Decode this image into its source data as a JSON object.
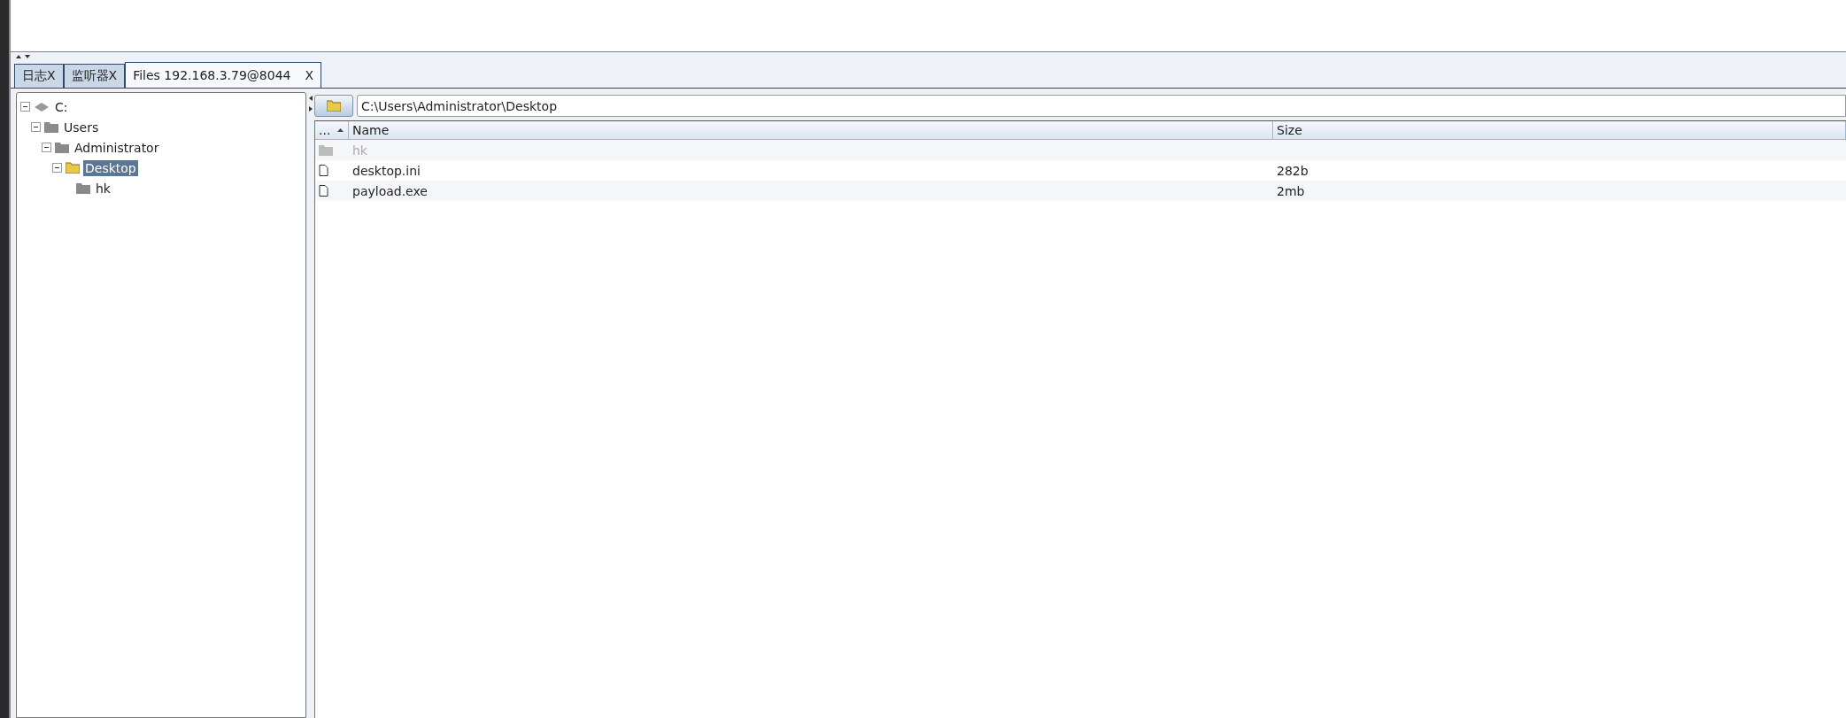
{
  "tabs": [
    {
      "label": "日志X",
      "selected": false
    },
    {
      "label": "监听器X",
      "selected": false
    },
    {
      "label": "Files 192.168.3.79@8044",
      "close": "X",
      "selected": true
    }
  ],
  "tree": [
    {
      "label": "C:",
      "kind": "drive",
      "expanded": true,
      "selected": false,
      "children": [
        {
          "label": "Users",
          "kind": "folder",
          "expanded": true,
          "selected": false,
          "children": [
            {
              "label": "Administrator",
              "kind": "folder",
              "expanded": true,
              "selected": false,
              "children": [
                {
                  "label": "Desktop",
                  "kind": "folder",
                  "expanded": true,
                  "selected": true,
                  "children": [
                    {
                      "label": "hk",
                      "kind": "folder",
                      "expanded": false,
                      "selected": false
                    }
                  ]
                }
              ]
            }
          ]
        }
      ]
    }
  ],
  "path": {
    "value": "C:\\Users\\Administrator\\Desktop"
  },
  "table": {
    "columns": [
      "...",
      "Name",
      "Size"
    ],
    "rows": [
      {
        "kind": "folder",
        "name": "hk",
        "size": "",
        "disabled": true
      },
      {
        "kind": "file",
        "name": "desktop.ini",
        "size": "282b",
        "disabled": false
      },
      {
        "kind": "file",
        "name": "payload.exe",
        "size": "2mb",
        "disabled": false
      }
    ]
  }
}
